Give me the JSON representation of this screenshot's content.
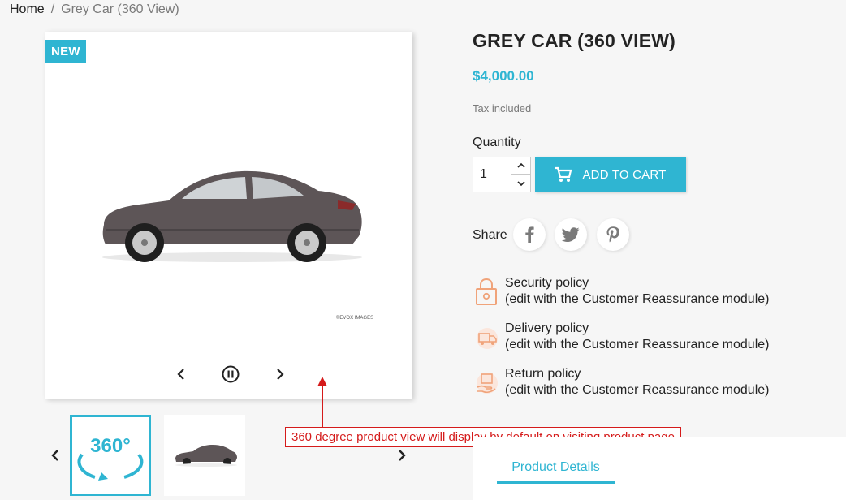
{
  "breadcrumb": {
    "home": "Home",
    "separator": "/",
    "current": "Grey Car (360 View)"
  },
  "product": {
    "badge": "NEW",
    "title": "GREY CAR (360 VIEW)",
    "price": "$4,000.00",
    "tax_note": "Tax included",
    "watermark": "©EVOX IMAGES",
    "thumbnail_360_label": "360°"
  },
  "quantity": {
    "label": "Quantity",
    "value": "1"
  },
  "cart": {
    "label": "ADD TO CART"
  },
  "share": {
    "label": "Share"
  },
  "policies": [
    {
      "title": "Security policy",
      "subtitle": "(edit with the Customer Reassurance module)"
    },
    {
      "title": "Delivery policy",
      "subtitle": "(edit with the Customer Reassurance module)"
    },
    {
      "title": "Return policy",
      "subtitle": "(edit with the Customer Reassurance module)"
    }
  ],
  "annotation": {
    "text": "360 degree product view will display by default on visiting product page"
  },
  "tabs": {
    "product_details": "Product Details"
  },
  "colors": {
    "accent": "#2fb5d2",
    "annotation": "#d51b1b",
    "background": "#f6f6f6"
  },
  "icons": [
    "cart-icon",
    "facebook-icon",
    "twitter-icon",
    "pinterest-icon",
    "lock-icon",
    "truck-icon",
    "return-box-icon"
  ]
}
